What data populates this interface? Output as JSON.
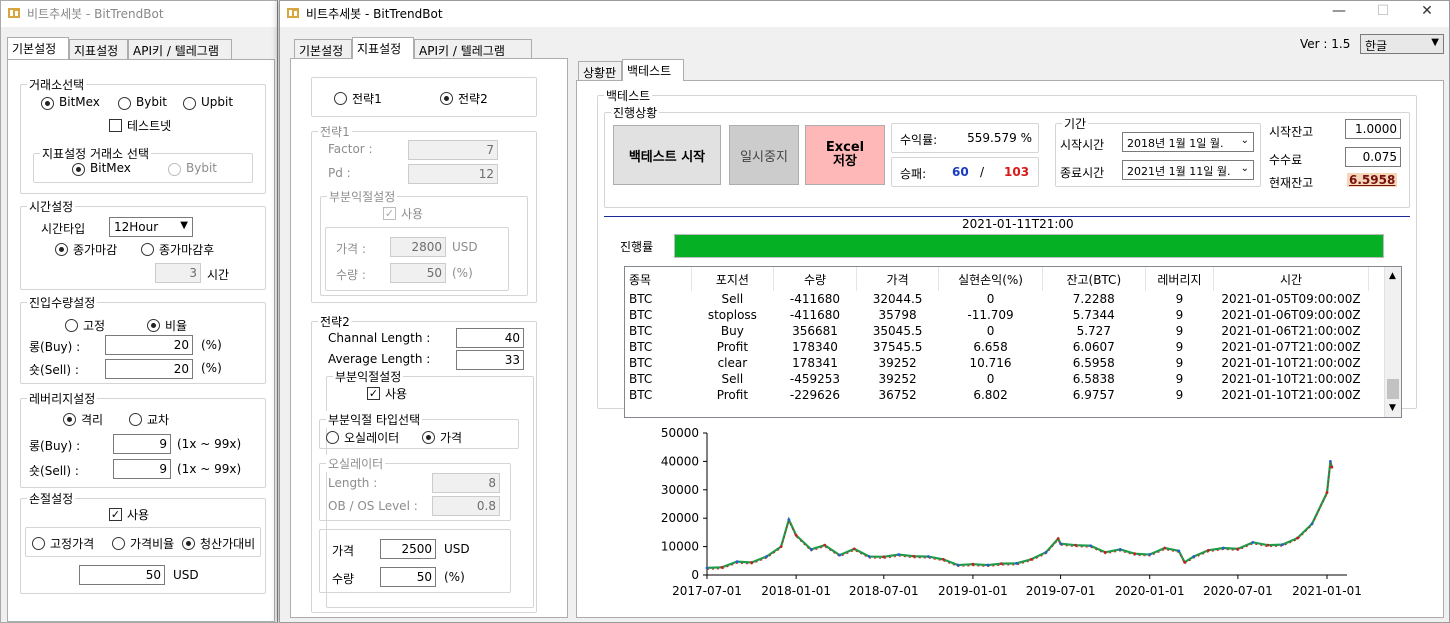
{
  "back_window": {
    "title": "비트추세봇 - BitTrendBot",
    "tabs": [
      "기본설정",
      "지표설정",
      "API키 / 텔레그램"
    ],
    "exchange": {
      "title": "거래소선택",
      "options": [
        "BitMex",
        "Bybit",
        "Upbit"
      ],
      "testnet": "테스트넷",
      "indicator_title": "지표설정 거래소 선택",
      "indicator_options": [
        "BitMex",
        "Bybit"
      ]
    },
    "time": {
      "title": "시간설정",
      "type_label": "시간타입",
      "type_value": "12Hour",
      "options": [
        "종가마감",
        "종가마감후"
      ],
      "after_value": "3",
      "after_unit": "시간"
    },
    "entry": {
      "title": "진입수량설정",
      "options": [
        "고정",
        "비율"
      ],
      "long_label": "롱(Buy) :",
      "long_value": "20",
      "short_label": "숏(Sell) :",
      "short_value": "20",
      "unit": "(%)"
    },
    "leverage": {
      "title": "레버리지설정",
      "options": [
        "격리",
        "교차"
      ],
      "long_label": "롱(Buy) :",
      "long_value": "9",
      "short_label": "숏(Sell) :",
      "short_value": "9",
      "range": "(1x ~ 99x)"
    },
    "stoploss": {
      "title": "손절설정",
      "use": "사용",
      "options": [
        "고정가격",
        "가격비율",
        "청산가대비"
      ],
      "value": "50",
      "unit": "USD"
    }
  },
  "main_window": {
    "title": "비트추세봇 - BitTrendBot",
    "controls": [
      "—",
      "☐",
      "✕"
    ],
    "version": "Ver : 1.5",
    "language": "한글",
    "tabs": [
      "기본설정",
      "지표설정",
      "API키 / 텔레그램"
    ],
    "strategy": {
      "options": [
        "전략1",
        "전략2"
      ]
    },
    "s1": {
      "title": "전략1",
      "factor_label": "Factor :",
      "factor_value": "7",
      "pd_label": "Pd :",
      "pd_value": "12",
      "partial_title": "부분익절설정",
      "use": "사용",
      "price_label": "가격 :",
      "price_value": "2800",
      "price_unit": "USD",
      "qty_label": "수량 :",
      "qty_value": "50",
      "qty_unit": "(%)"
    },
    "s2": {
      "title": "전략2",
      "channel_label": "Channal Length :",
      "channel_value": "40",
      "average_label": "Average Length :",
      "average_value": "33",
      "partial_title": "부분익절설정",
      "use": "사용",
      "type_title": "부분익절 타입선택",
      "type_options": [
        "오실레이터",
        "가격"
      ],
      "osc_title": "오실레이터",
      "length_label": "Length :",
      "length_value": "8",
      "obos_label": "OB / OS Level :",
      "obos_value": "0.8",
      "price_label": "가격",
      "price_value": "2500",
      "price_unit": "USD",
      "qty_label": "수량",
      "qty_value": "50",
      "qty_unit": "(%)"
    },
    "right_tabs": [
      "상황판",
      "백테스트"
    ],
    "backtest": {
      "title": "백테스트",
      "progress_title": "진행상황",
      "start_btn": "백테스트 시작",
      "pause_btn": "일시중지",
      "excel_btn": "Excel 저장",
      "profit_label": "수익률:",
      "profit_value": "559.579 %",
      "winloss_label": "승패:",
      "wins": "60",
      "sep": "/",
      "losses": "103",
      "period_title": "기간",
      "start_label": "시작시간",
      "start_value": "2018년   1월   1일 월.",
      "end_label": "종료시간",
      "end_value": "2021년   1월 11일 월.",
      "start_bal_label": "시작잔고",
      "start_bal_value": "1.0000",
      "fee_label": "수수료",
      "fee_value": "0.075",
      "cur_bal_label": "현재잔고",
      "cur_bal_value": "6.5958",
      "timestamp": "2021-01-11T21:00",
      "rate_label": "진행률",
      "progress": 1.0,
      "table": {
        "headers": [
          "종목",
          "포지션",
          "수량",
          "가격",
          "실현손익(%)",
          "잔고(BTC)",
          "레버리지",
          "시간"
        ],
        "rows": [
          [
            "BTC",
            "Sell",
            "-411680",
            "32044.5",
            "0",
            "7.2288",
            "9",
            "2021-01-05T09:00:00Z"
          ],
          [
            "BTC",
            "stoploss",
            "-411680",
            "35798",
            "-11.709",
            "5.7344",
            "9",
            "2021-01-06T09:00:00Z"
          ],
          [
            "BTC",
            "Buy",
            "356681",
            "35045.5",
            "0",
            "5.727",
            "9",
            "2021-01-06T21:00:00Z"
          ],
          [
            "BTC",
            "Profit",
            "178340",
            "37545.5",
            "6.658",
            "6.0607",
            "9",
            "2021-01-07T21:00:00Z"
          ],
          [
            "BTC",
            "clear",
            "178341",
            "39252",
            "10.716",
            "6.5958",
            "9",
            "2021-01-10T21:00:00Z"
          ],
          [
            "BTC",
            "Sell",
            "-459253",
            "39252",
            "0",
            "6.5838",
            "9",
            "2021-01-10T21:00:00Z"
          ],
          [
            "BTC",
            "Profit",
            "-229626",
            "36752",
            "6.802",
            "6.9757",
            "9",
            "2021-01-10T21:00:00Z"
          ]
        ]
      }
    }
  },
  "chart_data": {
    "type": "line",
    "ylim": [
      0,
      50000
    ],
    "yticks": [
      "0",
      "10000",
      "20000",
      "30000",
      "40000",
      "50000"
    ],
    "xticks": [
      "2017-07-01",
      "2018-01-01",
      "2018-07-01",
      "2019-01-01",
      "2019-07-01",
      "2020-01-01",
      "2020-07-01",
      "2021-01-01"
    ],
    "x": [
      "2017-07-01",
      "2017-08-01",
      "2017-09-01",
      "2017-10-01",
      "2017-11-01",
      "2017-12-01",
      "2017-12-17",
      "2018-01-01",
      "2018-02-01",
      "2018-03-01",
      "2018-04-01",
      "2018-05-01",
      "2018-06-01",
      "2018-07-01",
      "2018-08-01",
      "2018-09-01",
      "2018-10-01",
      "2018-11-01",
      "2018-12-01",
      "2019-01-01",
      "2019-02-01",
      "2019-03-01",
      "2019-04-01",
      "2019-05-01",
      "2019-06-01",
      "2019-06-26",
      "2019-07-01",
      "2019-08-01",
      "2019-09-01",
      "2019-10-01",
      "2019-11-01",
      "2019-12-01",
      "2020-01-01",
      "2020-02-01",
      "2020-03-01",
      "2020-03-13",
      "2020-04-01",
      "2020-05-01",
      "2020-06-01",
      "2020-07-01",
      "2020-08-01",
      "2020-09-01",
      "2020-10-01",
      "2020-11-01",
      "2020-12-01",
      "2021-01-01",
      "2021-01-08",
      "2021-01-11"
    ],
    "y": [
      2500,
      2700,
      4700,
      4400,
      6500,
      10000,
      19500,
      14000,
      9000,
      10500,
      7000,
      9200,
      6500,
      6400,
      7200,
      6600,
      6500,
      5500,
      3500,
      3800,
      3500,
      4000,
      4100,
      5500,
      8000,
      12800,
      11000,
      10500,
      10300,
      8000,
      9000,
      7500,
      7200,
      9500,
      8500,
      4500,
      6500,
      8700,
      9500,
      9200,
      11500,
      10500,
      10700,
      13000,
      18000,
      29000,
      40000,
      38000
    ]
  }
}
